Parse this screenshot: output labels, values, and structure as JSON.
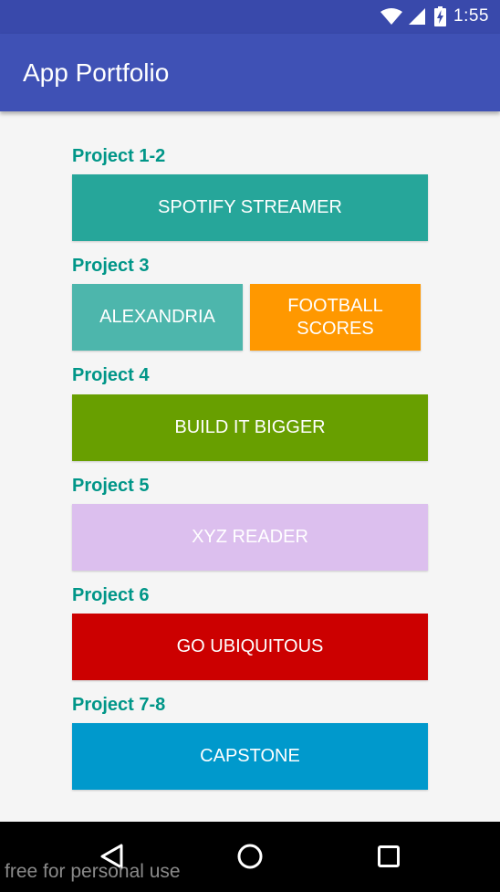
{
  "status_bar": {
    "time": "1:55",
    "icons": [
      "wifi-icon",
      "cellular-signal-icon",
      "battery-charging-icon"
    ]
  },
  "app_bar": {
    "title": "App Portfolio"
  },
  "sections": [
    {
      "label": "Project 1-2",
      "buttons": [
        {
          "label": "SPOTIFY STREAMER",
          "color": "#26a69a"
        }
      ]
    },
    {
      "label": "Project 3",
      "buttons": [
        {
          "label": "ALEXANDRIA",
          "color": "#4db6ac"
        },
        {
          "label": "FOOTBALL SCORES",
          "color": "#ff9800"
        }
      ]
    },
    {
      "label": "Project 4",
      "buttons": [
        {
          "label": "BUILD IT BIGGER",
          "color": "#689f00"
        }
      ]
    },
    {
      "label": "Project 5",
      "buttons": [
        {
          "label": "XYZ READER",
          "color": "#dcbfee"
        }
      ]
    },
    {
      "label": "Project 6",
      "buttons": [
        {
          "label": "GO UBIQUITOUS",
          "color": "#cc0000"
        }
      ]
    },
    {
      "label": "Project 7-8",
      "buttons": [
        {
          "label": "CAPSTONE",
          "color": "#0099cc"
        }
      ]
    }
  ],
  "nav_bar": {
    "icons": [
      "back-icon",
      "home-icon",
      "recents-icon"
    ]
  },
  "watermark": "free for personal use",
  "colors": {
    "primary": "#3f51b5",
    "primary_dark": "#3949ab",
    "accent_text": "#009688",
    "background": "#f5f5f5"
  }
}
